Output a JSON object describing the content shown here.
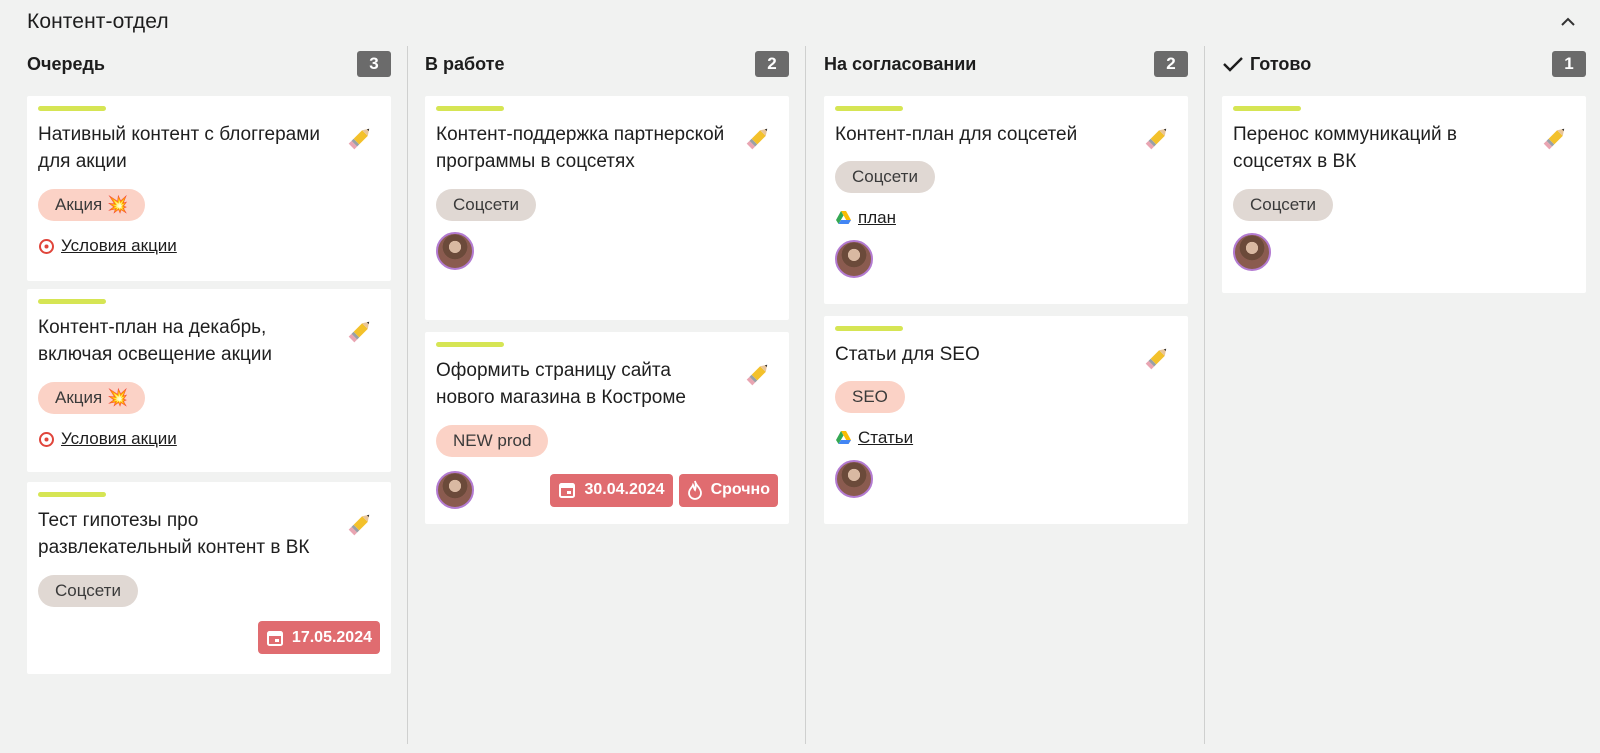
{
  "board": {
    "title": "Контент-отдел"
  },
  "columns": [
    {
      "title": "Очередь",
      "count": "3",
      "cards": [
        {
          "title": "Нативный контент с блоггерами для акции",
          "tag": "Акция 💥",
          "link": "Условия акции"
        },
        {
          "title": "Контент-план на декабрь, включая освещение акции",
          "tag": "Акция 💥",
          "link": "Условия акции"
        },
        {
          "title": "Тест гипотезы про развлекательный контент в ВК",
          "tag": "Соцсети",
          "date": "17.05.2024"
        }
      ]
    },
    {
      "title": "В работе",
      "count": "2",
      "cards": [
        {
          "title": "Контент-поддержка партнерской программы в соцсетях",
          "tag": "Соцсети"
        },
        {
          "title": "Оформить страницу сайта нового магазина в Костроме",
          "tag": "NEW prod",
          "date": "30.04.2024",
          "urgent": "Срочно"
        }
      ]
    },
    {
      "title": "На согласовании",
      "count": "2",
      "cards": [
        {
          "title": "Контент-план для соцсетей",
          "tag": "Соцсети",
          "link": "план"
        },
        {
          "title": "Статьи для SEO",
          "tag": "SEO",
          "link": "Статьи"
        }
      ]
    },
    {
      "title": "Готово",
      "count": "1",
      "cards": [
        {
          "title": "Перенос коммуникаций в соцсетях в ВК",
          "tag": "Соцсети"
        }
      ]
    }
  ],
  "icons": {
    "edit": "pencil-icon",
    "calendar": "calendar-icon",
    "fire": "fire-icon",
    "drive": "google-drive-icon",
    "target": "target-icon",
    "check": "check-icon",
    "collapse": "chevron-up-icon"
  },
  "colors": {
    "accent": "#d6e554",
    "badge": "#e06c70",
    "count": "#6b6b6b",
    "avatar_ring": "#b37bd1"
  }
}
